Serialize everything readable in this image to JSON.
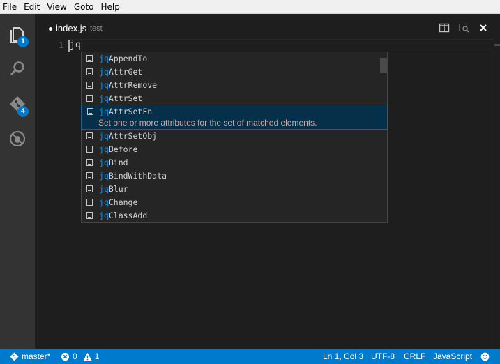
{
  "menubar": {
    "items": [
      "File",
      "Edit",
      "View",
      "Goto",
      "Help"
    ]
  },
  "activitybar": {
    "explorer_badge": "1",
    "git_badge": "4"
  },
  "tab": {
    "name": "index.js",
    "description": "test"
  },
  "editor": {
    "line_number": "1",
    "line_text": "jq"
  },
  "suggest": {
    "highlight_prefix": "jq",
    "items": [
      {
        "rest": "AppendTo"
      },
      {
        "rest": "AttrGet"
      },
      {
        "rest": "AttrRemove"
      },
      {
        "rest": "AttrSet"
      },
      {
        "rest": "AttrSetFn",
        "doc": "Set one or more attributes for the set of matched elements."
      },
      {
        "rest": "AttrSetObj"
      },
      {
        "rest": "Before"
      },
      {
        "rest": "Bind"
      },
      {
        "rest": "BindWithData"
      },
      {
        "rest": "Blur"
      },
      {
        "rest": "Change"
      },
      {
        "rest": "ClassAdd"
      }
    ],
    "selected_index": 4
  },
  "statusbar": {
    "branch": "master*",
    "errors": "0",
    "warnings": "1",
    "position": "Ln 1, Col 3",
    "encoding": "UTF-8",
    "eol": "CRLF",
    "language": "JavaScript"
  },
  "colors": {
    "accent": "#007acc",
    "selection": "#062f4a",
    "match_highlight": "#0097fb"
  }
}
